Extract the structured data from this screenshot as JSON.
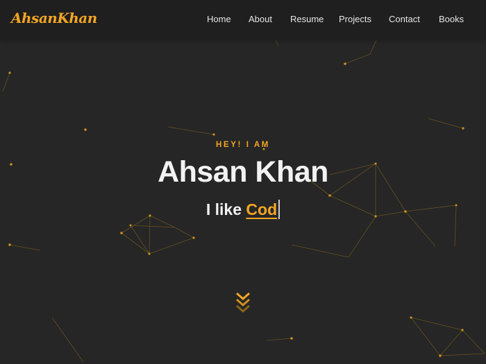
{
  "brand": {
    "logo_text": "AhsanKhan",
    "accent_color": "#f5a623"
  },
  "nav": {
    "items": [
      {
        "label": "Home"
      },
      {
        "label": "About"
      },
      {
        "label": "Resume"
      },
      {
        "label": "Projects"
      },
      {
        "label": "Contact"
      },
      {
        "label": "Books"
      }
    ]
  },
  "hero": {
    "kicker": "HEY! I AM",
    "name": "Ahsan Khan",
    "tagline_prefix": "I like ",
    "tagline_typed": "Cod"
  },
  "icons": {
    "scroll_down": "chevron-double-down-icon",
    "background": "particle-network"
  },
  "colors": {
    "background": "#262626",
    "navbar": "#1f1f1f",
    "text": "#f2f2f2",
    "particle_line": "#8a6a1e"
  }
}
